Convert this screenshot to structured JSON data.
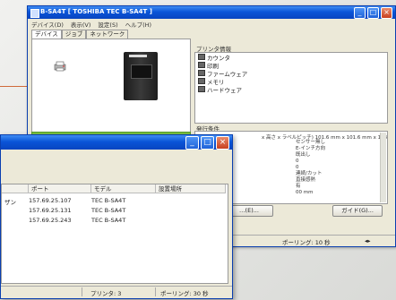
{
  "back_window": {
    "title": "B-SA4T [ TOSHIBA TEC B-SA4T ]",
    "menu": [
      "デバイス(D)",
      "表示(V)",
      "設定(S)",
      "ヘルプ(H)"
    ],
    "tabs": [
      "デバイス",
      "ジョブ",
      "ネットワーク"
    ],
    "info_group_label": "プリンタ情報",
    "info_items": [
      "カウンタ",
      "印刷",
      "ファームウェア",
      "メモリ",
      "ハードウェア"
    ],
    "cond_group_label": "発行条件",
    "cond_header": "x 高さ x ラベルピッチ) 101.6 mm x 101.6 mm x 103.6...",
    "cond_values": [
      "センサー無し",
      "E-インチ方向",
      "既出し",
      "0",
      "0",
      "連続/カット",
      "直接感熱",
      "有",
      "00 mm"
    ],
    "button_left": "…(E)...",
    "button_right": "ガイド(G)...",
    "status_polling": "ポーリング: 10 秒"
  },
  "front_window": {
    "columns": [
      "ポート",
      "モデル",
      "設置場所"
    ],
    "rows": [
      {
        "prefix": "ザン",
        "port": "157.69.25.107",
        "model": "TEC B-SA4T",
        "location": ""
      },
      {
        "prefix": "",
        "port": "157.69.25.131",
        "model": "TEC B-SA4T",
        "location": ""
      },
      {
        "prefix": "",
        "port": "157.69.25.243",
        "model": "TEC B-SA4T",
        "location": ""
      }
    ],
    "status_printers": "プリンタ: 3",
    "status_polling": "ポーリング: 30 秒"
  }
}
